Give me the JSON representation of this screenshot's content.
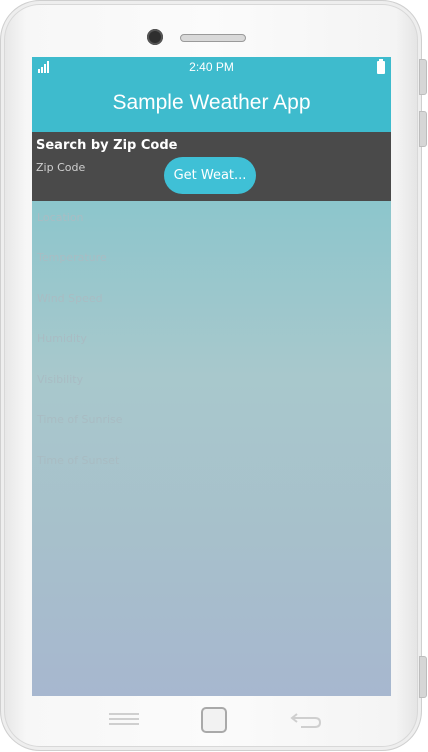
{
  "statusbar": {
    "time": "2:40 PM"
  },
  "appbar": {
    "title": "Sample Weather App"
  },
  "search": {
    "label": "Search by Zip Code",
    "zip_placeholder": "Zip Code",
    "button_label": "Get Weat..."
  },
  "fields": {
    "location": "Location",
    "temperature": "Temperature",
    "wind_speed": "Wind Speed",
    "humidity": "Humidity",
    "visibility": "Visibility",
    "sunrise": "Time of Sunrise",
    "sunset": "Time of Sunset"
  },
  "colors": {
    "accent": "#3ebbcd",
    "button": "#3fc0d6",
    "panel": "#4a4a4a"
  }
}
